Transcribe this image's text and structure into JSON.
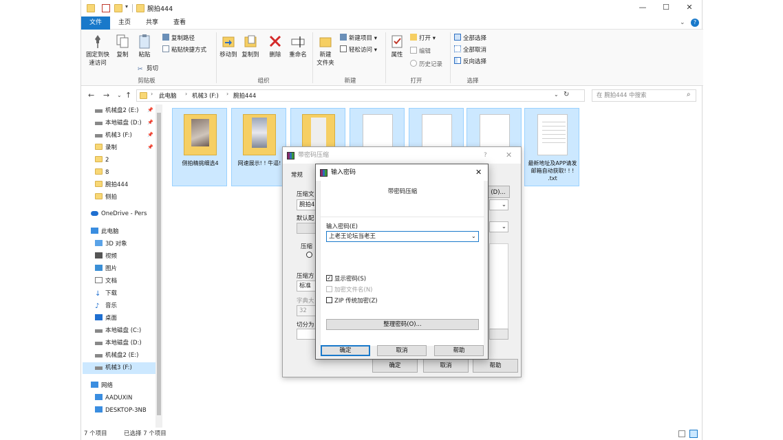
{
  "window": {
    "title": "腕拍444",
    "controls": {
      "minimize": "—",
      "maximize": "☐",
      "close": "✕"
    }
  },
  "ribbon": {
    "tabs": [
      "文件",
      "主页",
      "共享",
      "查看"
    ],
    "clipboard": {
      "pin_label_1": "固定到快",
      "pin_label_2": "速访问",
      "copy": "复制",
      "paste": "粘贴",
      "copy_path": "复制路径",
      "paste_shortcut": "粘贴快捷方式",
      "cut": "剪切",
      "group": "剪贴板"
    },
    "organize": {
      "move_to": "移动到",
      "copy_to": "复制到",
      "delete": "删除",
      "rename": "重命名",
      "group": "组织"
    },
    "new": {
      "new_folder_1": "新建",
      "new_folder_2": "文件夹",
      "new_item": "新建项目",
      "easy_access": "轻松访问",
      "group": "新建"
    },
    "open": {
      "properties": "属性",
      "open": "打开",
      "edit": "编辑",
      "history": "历史记录",
      "group": "打开"
    },
    "select": {
      "select_all": "全部选择",
      "select_none": "全部取消",
      "invert": "反向选择",
      "group": "选择"
    }
  },
  "address": {
    "path": [
      "此电脑",
      "机械3 (F:)",
      "腕拍444"
    ],
    "search_placeholder": "在 腕拍444 中搜索"
  },
  "nav": {
    "items": [
      {
        "label": "机械盘2 (E:)",
        "pinned": true
      },
      {
        "label": "本地磁盘 (D:)",
        "pinned": true
      },
      {
        "label": "机械3 (F:)",
        "pinned": true
      },
      {
        "label": "录制",
        "pinned": true
      },
      {
        "label": "2",
        "pinned": false
      },
      {
        "label": "8",
        "pinned": false
      },
      {
        "label": "腕拍444",
        "pinned": false
      },
      {
        "label": "侧拍",
        "pinned": false
      },
      {
        "label": "OneDrive - Pers",
        "pinned": false
      },
      {
        "label": "此电脑",
        "pinned": false
      },
      {
        "label": "3D 对象",
        "pinned": false
      },
      {
        "label": "视频",
        "pinned": false
      },
      {
        "label": "图片",
        "pinned": false
      },
      {
        "label": "文档",
        "pinned": false
      },
      {
        "label": "下载",
        "pinned": false
      },
      {
        "label": "音乐",
        "pinned": false
      },
      {
        "label": "桌面",
        "pinned": false
      },
      {
        "label": "本地磁盘 (C:)",
        "pinned": false
      },
      {
        "label": "本地磁盘 (D:)",
        "pinned": false
      },
      {
        "label": "机械盘2 (E:)",
        "pinned": false
      },
      {
        "label": "机械3 (F:)",
        "pinned": false
      },
      {
        "label": "网络",
        "pinned": false
      },
      {
        "label": "AADUXIN",
        "pinned": false
      },
      {
        "label": "DESKTOP-3NB",
        "pinned": false
      }
    ]
  },
  "files": [
    {
      "name": "侧拍精挑细选4",
      "kind": "folder"
    },
    {
      "name": "网速展示! ! 牛逼!",
      "kind": "folder"
    },
    {
      "name": "",
      "kind": "folder"
    },
    {
      "name": "",
      "kind": "doc"
    },
    {
      "name": "",
      "kind": "doc"
    },
    {
      "name": "",
      "kind": "doc"
    },
    {
      "name": "最新地址及APP请发邮箱自动获取! ! ! .txt",
      "kind": "doc"
    }
  ],
  "status": {
    "count": "7 个项目",
    "selected": "已选择 7 个项目"
  },
  "dialog_back": {
    "title": "带密码压缩",
    "help": "?",
    "close": "✕",
    "tab": "常规",
    "archive_label": "压缩文",
    "archive_value": "腕拍4",
    "browse": "(D)...",
    "profile_label": "默认配",
    "format_label": "压缩",
    "method_label": "压缩方",
    "method_value": "标准",
    "dict_label": "字典大",
    "dict_value": "32",
    "split_label": "切分为",
    "ok": "确定",
    "cancel": "取消",
    "help_btn": "帮助"
  },
  "dialog_front": {
    "title": "输入密码",
    "close": "✕",
    "subtitle": "带密码压缩",
    "password_label": "输入密码(E)",
    "password_value": "上老王论坛当老王",
    "show_password": "显示密码(S)",
    "encrypt_names": "加密文件名(N)",
    "zip_legacy": "ZIP 传统加密(Z)",
    "organize": "整理密码(O)...",
    "ok": "确定",
    "cancel": "取消",
    "help": "帮助"
  }
}
